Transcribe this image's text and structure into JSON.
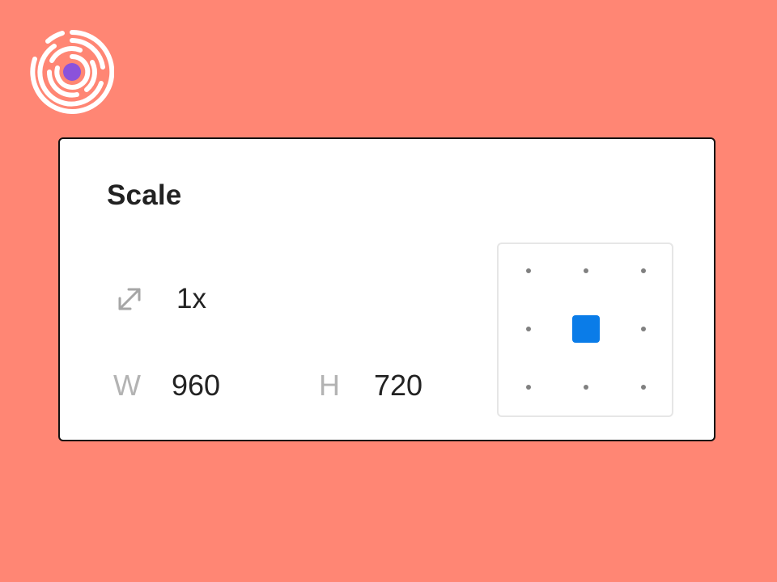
{
  "app": {
    "brand_colors": {
      "background": "#FF8674",
      "logo_dot": "#8B52DB",
      "accent": "#0A7CE8"
    }
  },
  "panel": {
    "title": "Scale",
    "scale": {
      "icon": "resize-diagonal-icon",
      "value": "1x"
    },
    "width": {
      "label": "W",
      "value": "960"
    },
    "height": {
      "label": "H",
      "value": "720"
    },
    "anchor": {
      "selected": "center",
      "positions": [
        "top-left",
        "top",
        "top-right",
        "left",
        "center",
        "right",
        "bottom-left",
        "bottom",
        "bottom-right"
      ]
    }
  }
}
